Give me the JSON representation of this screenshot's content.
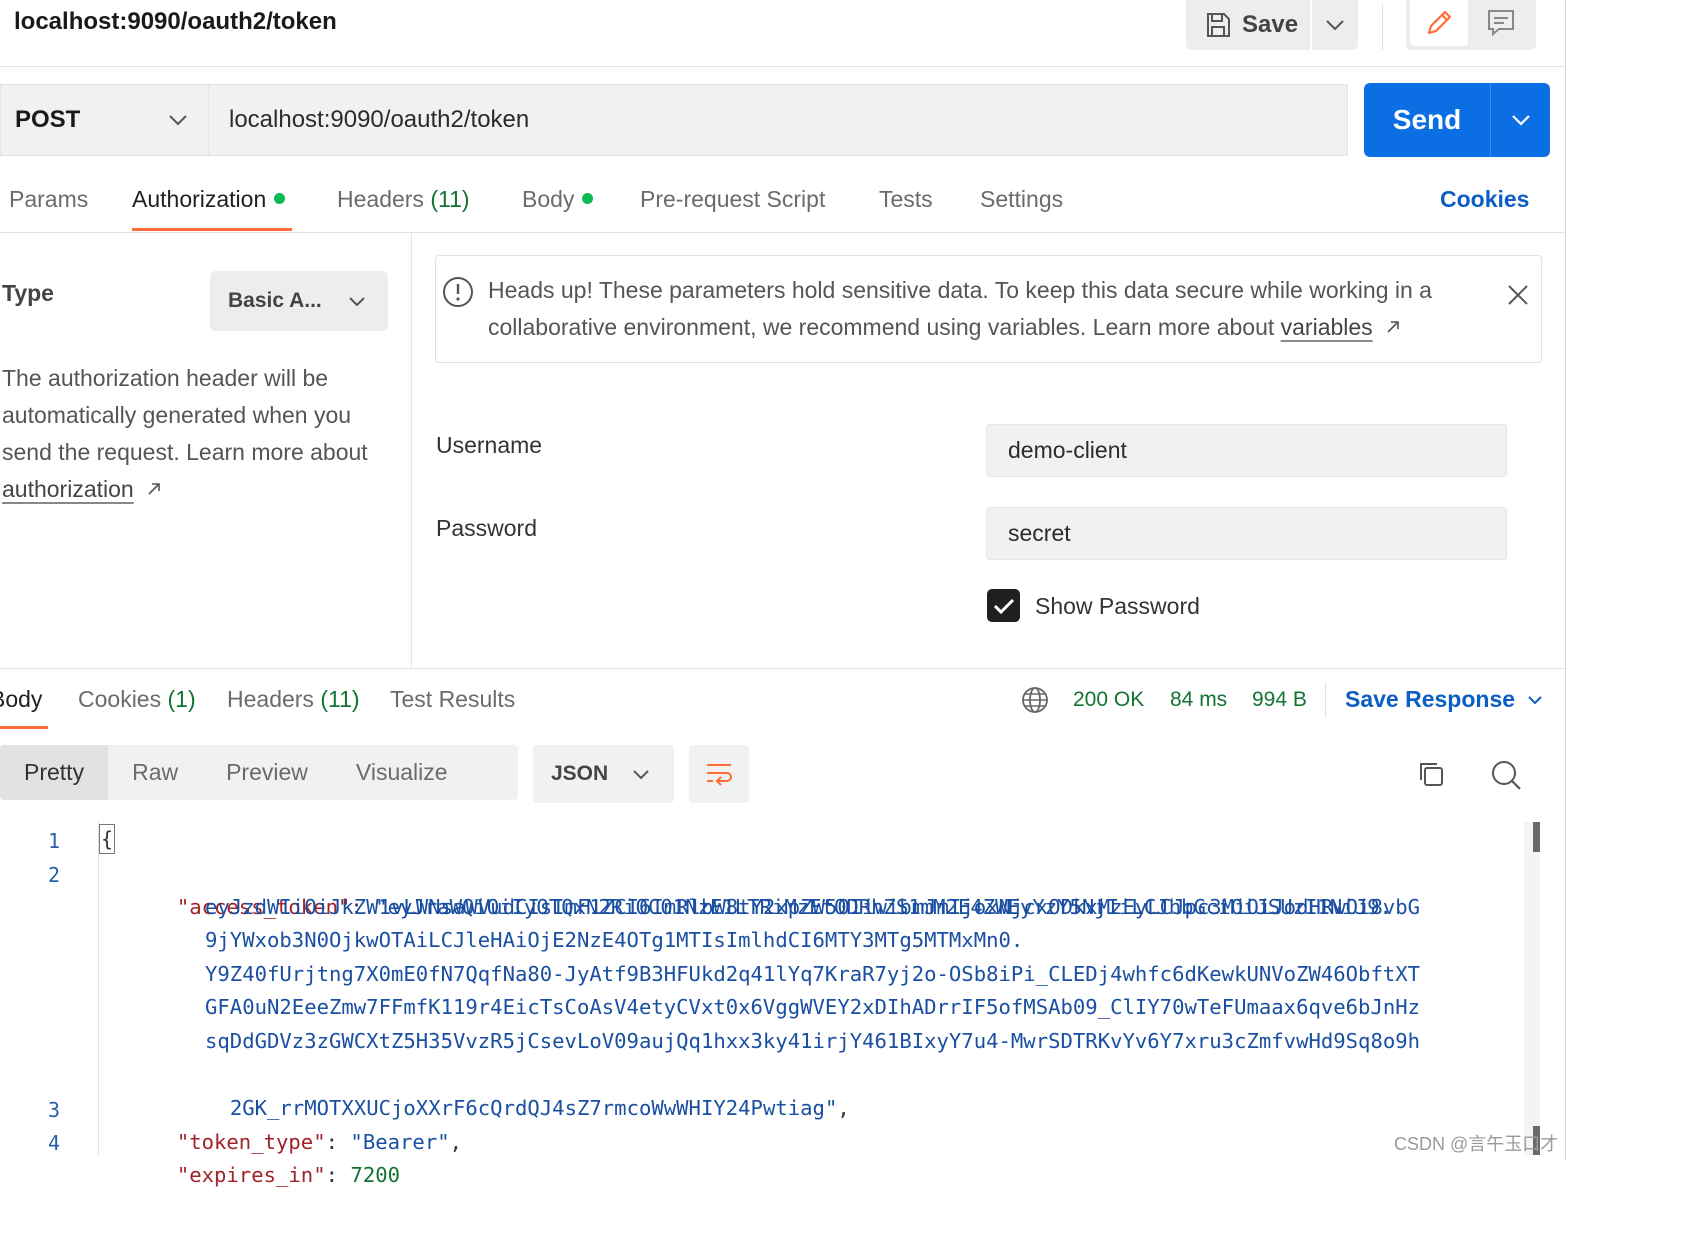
{
  "header": {
    "title": "localhost:9090/oauth2/token",
    "save_label": "Save"
  },
  "request": {
    "method": "POST",
    "url": "localhost:9090/oauth2/token",
    "send_label": "Send"
  },
  "request_tabs": {
    "params": "Params",
    "authorization": "Authorization",
    "headers": "Headers",
    "headers_count": "(11)",
    "body": "Body",
    "pre_request": "Pre-request Script",
    "tests": "Tests",
    "settings": "Settings",
    "cookies": "Cookies"
  },
  "auth": {
    "type_label": "Type",
    "type_value": "Basic A...",
    "help_text": "The authorization header will be automatically generated when you send the request. Learn more about ",
    "help_link": "authorization",
    "alert_text": "Heads up! These parameters hold sensitive data. To keep this data secure while working in a collaborative environment, we recommend using variables. Learn more about ",
    "alert_link": "variables",
    "username_label": "Username",
    "username_value": "demo-client",
    "password_label": "Password",
    "password_value": "secret",
    "show_password_label": "Show Password",
    "show_password_checked": true
  },
  "response_tabs": {
    "body": "Body",
    "cookies": "Cookies",
    "cookies_count": "(1)",
    "headers": "Headers",
    "headers_count": "(11)",
    "test_results": "Test Results"
  },
  "response_status": {
    "status": "200 OK",
    "time": "84 ms",
    "size": "994 B",
    "save_response": "Save Response"
  },
  "view": {
    "pretty": "Pretty",
    "raw": "Raw",
    "preview": "Preview",
    "visualize": "Visualize",
    "format": "JSON"
  },
  "response_body": {
    "line_numbers": [
      "1",
      "2",
      "3",
      "4"
    ],
    "open_brace": "{",
    "access_token_key": "\"access_token\"",
    "access_token_lines": [
      "\"eyJraWQiOiIyOTQxN2RiOC01NzE1LTRiMzEtODRhZS1mM2E4ZWEyYzY5NjIiLCJhbGciOiJSUzI1NiJ9.",
      "eyJzdWIiOiJkZW1vLWNsaWVudCIsImF1ZCI6ImRlbW8tY2xpZW50IiwibmJmIjoxNjcxODkxMzEyLCJpc3MiOiJodHRwOi8vbG",
      "9jYWxob3N0OjkwOTAiLCJleHAiOjE2NzE4OTg1MTIsImlhdCI6MTY3MTg5MTMxMn0.",
      "Y9Z40fUrjtng7X0mE0fN7QqfNa80-JyAtf9B3HFUkd2q41lYq7KraR7yj2o-OSb8iPi_CLEDj4whfc6dKewkUNVoZW46ObftXT",
      "GFA0uN2EeeZmw7FFmfK119r4EicTsCoAsV4etyCVxt0x6VggWVEY2xDIhADrrIF5ofMSAb09_ClIY70wTeFUmaax6qve6bJnHz",
      "sqDdGDVz3zGWCXtZ5H35VvzR5jCsevLoV09aujQq1hxx3ky41irjY461BIxyY7u4-MwrSDTRKvYv6Y7xru3cZmfvwHd9Sq8o9h",
      "2GK_rrMOTXXUCjoXXrF6cQrdQJ4sZ7rmcoWwWHIY24Pwtiag\""
    ],
    "token_type_key": "\"token_type\"",
    "token_type_value": "\"Bearer\"",
    "expires_in_key": "\"expires_in\"",
    "expires_in_value": "7200"
  },
  "watermark": "CSDN @言午玉口才",
  "colors": {
    "accent": "#ff6c37",
    "send_blue": "#0b6ee3",
    "link_blue": "#0b5fc4",
    "success_green": "#137333",
    "dot_green": "#0cbb52"
  }
}
